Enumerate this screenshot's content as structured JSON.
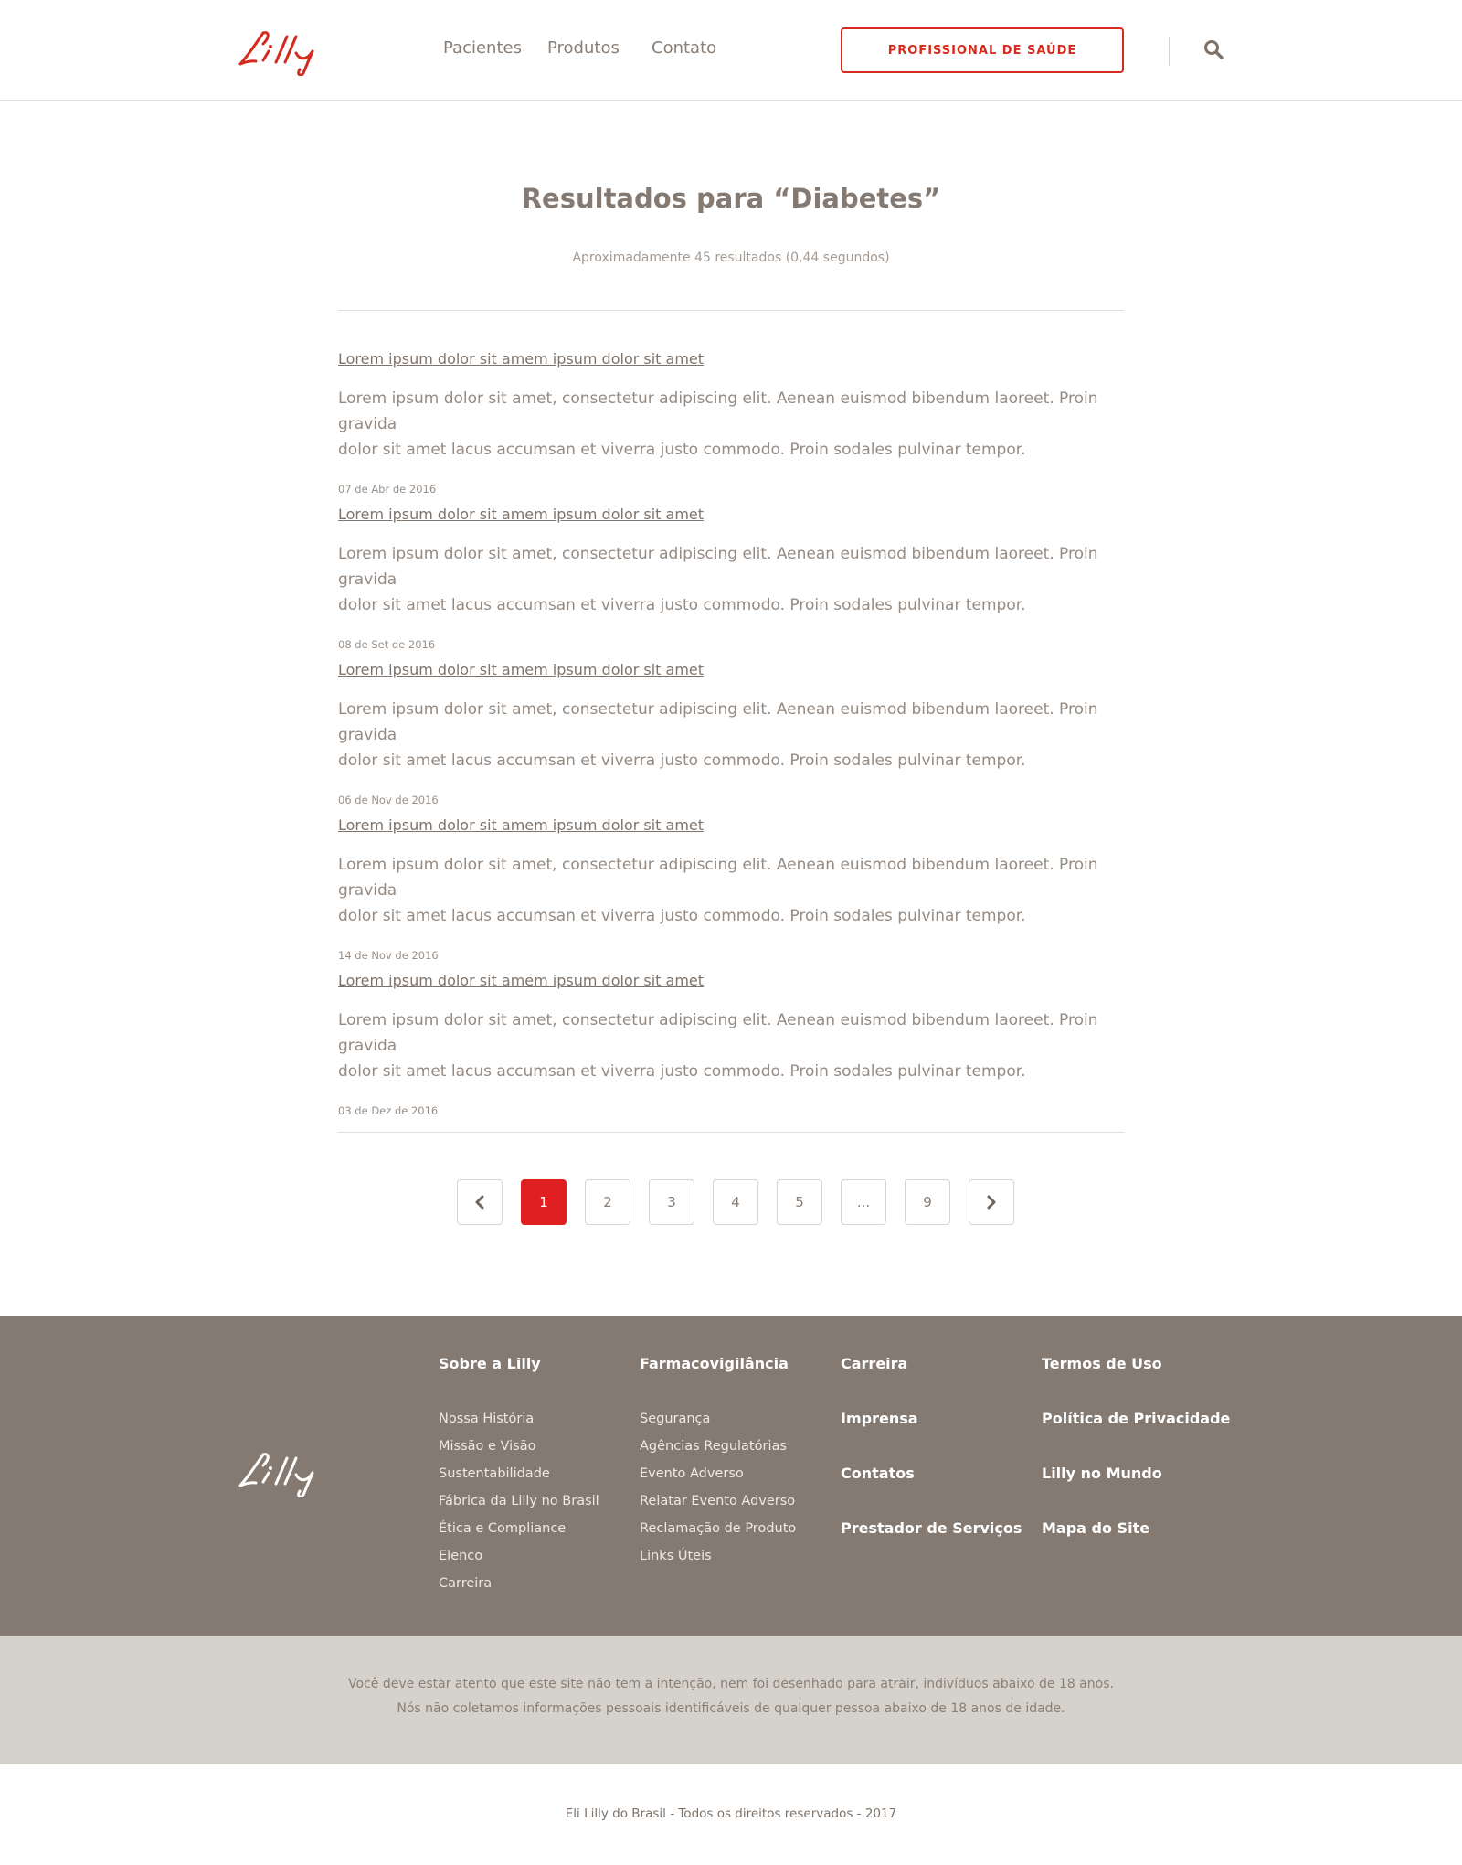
{
  "brand": {
    "name": "Lilly",
    "accent": "#d52b1e",
    "footer_bg": "#857a71",
    "disclaimer_bg": "#d5d2cb"
  },
  "header": {
    "nav": [
      "Pacientes",
      "Produtos",
      "Contato"
    ],
    "pro_button": "PROFISSIONAL DE SAÚDE",
    "search_icon": "search-icon"
  },
  "search": {
    "title": "Resultados para “Diabetes”",
    "count_text": "Aproximadamente 45 resultados (0,44 segundos)"
  },
  "results": [
    {
      "title": "Lorem ipsum dolor sit amem ipsum dolor sit amet",
      "snippet_1": "Lorem ipsum dolor sit amet, consectetur adipiscing elit. Aenean euismod bibendum laoreet. Proin gravida",
      "snippet_2": "dolor sit amet lacus accumsan et viverra justo commodo. Proin sodales pulvinar tempor.",
      "date": "07 de Abr de 2016"
    },
    {
      "title": "Lorem ipsum dolor sit amem ipsum dolor sit amet",
      "snippet_1": "Lorem ipsum dolor sit amet, consectetur adipiscing elit. Aenean euismod bibendum laoreet. Proin gravida",
      "snippet_2": "dolor sit amet lacus accumsan et viverra justo commodo. Proin sodales pulvinar tempor.",
      "date": "08 de Set de 2016"
    },
    {
      "title": "Lorem ipsum dolor sit amem ipsum dolor sit amet",
      "snippet_1": "Lorem ipsum dolor sit amet, consectetur adipiscing elit. Aenean euismod bibendum laoreet. Proin gravida",
      "snippet_2": "dolor sit amet lacus accumsan et viverra justo commodo. Proin sodales pulvinar tempor.",
      "date": "06 de Nov de 2016"
    },
    {
      "title": "Lorem ipsum dolor sit amem ipsum dolor sit amet",
      "snippet_1": "Lorem ipsum dolor sit amet, consectetur adipiscing elit. Aenean euismod bibendum laoreet. Proin gravida",
      "snippet_2": "dolor sit amet lacus accumsan et viverra justo commodo. Proin sodales pulvinar tempor.",
      "date": "14 de Nov de 2016"
    },
    {
      "title": "Lorem ipsum dolor sit amem ipsum dolor sit amet",
      "snippet_1": "Lorem ipsum dolor sit amet, consectetur adipiscing elit. Aenean euismod bibendum laoreet. Proin gravida",
      "snippet_2": "dolor sit amet lacus accumsan et viverra justo commodo. Proin sodales pulvinar tempor.",
      "date": "03 de Dez de 2016"
    }
  ],
  "pagination": {
    "pages": [
      "1",
      "2",
      "3",
      "4",
      "5",
      "...",
      "9"
    ],
    "active": "1"
  },
  "footer": {
    "col1": {
      "title": "Sobre a Lilly",
      "links": [
        "Nossa História",
        "Missão e Visão",
        "Sustentabilidade",
        "Fábrica da Lilly no Brasil",
        "Ética e Compliance",
        "Elenco",
        "Carreira"
      ]
    },
    "col2": {
      "title": "Farmacovigilância",
      "links": [
        "Segurança",
        "Agências Regulatórias",
        "Evento Adverso",
        "Relatar Evento Adverso",
        "Reclamação de Produto",
        "Links Úteis"
      ]
    },
    "col3": [
      "Carreira",
      "Imprensa",
      "Contatos",
      "Prestador de Serviços"
    ],
    "col4": [
      "Termos de Uso",
      "Política de Privacidade",
      "Lilly no Mundo",
      "Mapa do Site"
    ]
  },
  "disclaimer": {
    "line1": "Você deve estar atento que este site não tem a intenção, nem foi desenhado para atrair, indivíduos abaixo de 18 anos.",
    "line2": "Nós não coletamos informações pessoais identificáveis de qualquer pessoa abaixo de 18 anos de idade."
  },
  "copyright": "Eli Lilly do Brasil - Todos os direitos reservados - 2017"
}
